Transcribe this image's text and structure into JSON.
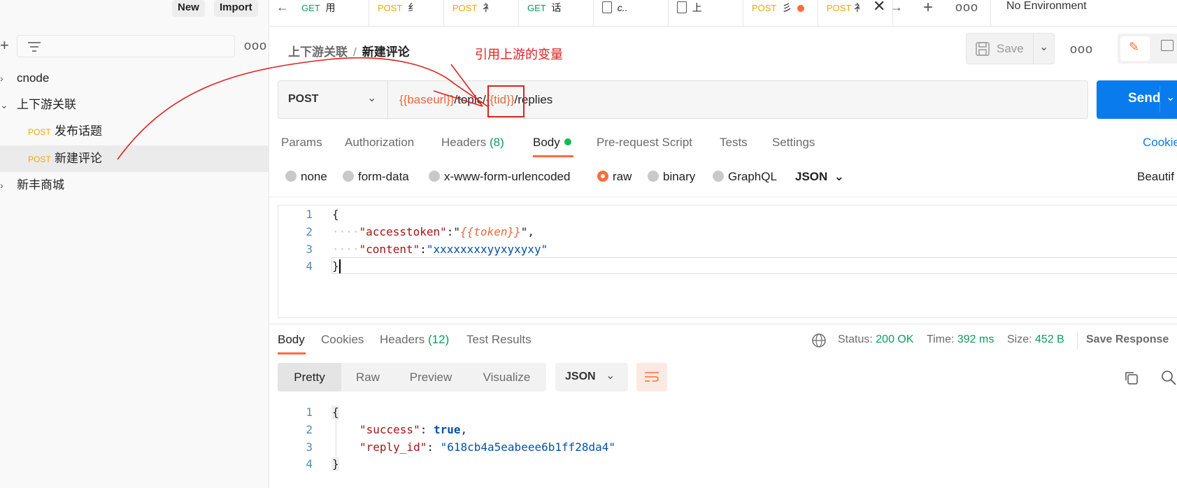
{
  "sidebar": {
    "new_label": "New",
    "import_label": "Import",
    "items": [
      {
        "label": "cnode"
      },
      {
        "label": "上下游关联"
      },
      {
        "method": "POST",
        "label": "发布话题"
      },
      {
        "method": "POST",
        "label": "新建评论"
      },
      {
        "label": "新丰商城"
      }
    ]
  },
  "tabs": [
    {
      "method": "GET",
      "label": "用"
    },
    {
      "method": "POST",
      "label": "纟"
    },
    {
      "method": "POST",
      "label": "衤"
    },
    {
      "method": "GET",
      "label": "话"
    },
    {
      "label": "c.."
    },
    {
      "label": "上"
    },
    {
      "method": "POST",
      "label": "彡"
    },
    {
      "method": "POST",
      "label": "衤"
    }
  ],
  "environment": "No Environment",
  "breadcrumb": {
    "parent": "上下游关联",
    "separator": "/",
    "current": "新建评论"
  },
  "save_label": "Save",
  "request": {
    "method": "POST",
    "url_parts": [
      "{{baseurl}}",
      "/topic/",
      "{{tid}}",
      "/replies"
    ],
    "send_label": "Send"
  },
  "request_tabs": {
    "params": "Params",
    "authorization": "Authorization",
    "headers": "Headers",
    "headers_count": "(8)",
    "body": "Body",
    "prerequest": "Pre-request Script",
    "tests": "Tests",
    "settings": "Settings",
    "cookies": "Cookie"
  },
  "body_types": [
    "none",
    "form-data",
    "x-www-form-urlencoded",
    "raw",
    "binary",
    "GraphQL"
  ],
  "body_format": "JSON",
  "beautify_label": "Beautif",
  "request_body": {
    "line_numbers": [
      "1",
      "2",
      "3",
      "4"
    ],
    "open": "{",
    "key1": "\"accesstoken\"",
    "val1": "{{token}}",
    "key2": "\"content\"",
    "val2": "\"xxxxxxxxyyxyxyxy\"",
    "close": "}"
  },
  "response_tabs": {
    "body": "Body",
    "cookies": "Cookies",
    "headers": "Headers",
    "headers_count": "(12)",
    "test_results": "Test Results"
  },
  "status": {
    "status_label": "Status:",
    "status_value": "200 OK",
    "time_label": "Time:",
    "time_value": "392 ms",
    "size_label": "Size:",
    "size_value": "452 B",
    "save_response": "Save Response"
  },
  "view_modes": [
    "Pretty",
    "Raw",
    "Preview",
    "Visualize"
  ],
  "response_format": "JSON",
  "response_body": {
    "line_numbers": [
      "1",
      "2",
      "3",
      "4"
    ],
    "open": "{",
    "key1": "\"success\"",
    "val1": "true",
    "key2": "\"reply_id\"",
    "val2": "\"618cb4a5eabeee6b1ff28da4\"",
    "close": "}"
  },
  "annotation": "引用上游的变量",
  "colors": {
    "accent": "#ff6c37",
    "send": "#097bed",
    "annotation": "#e02020",
    "variable": "#e8683b"
  }
}
